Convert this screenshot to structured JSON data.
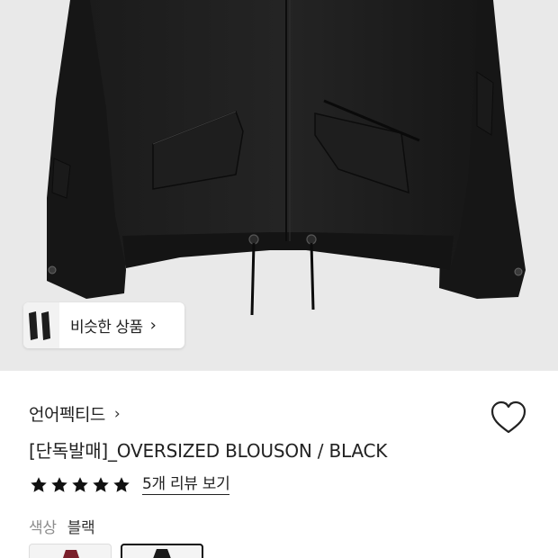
{
  "product_image": {
    "alt": "product-photo"
  },
  "similar": {
    "label": "비슷한 상품",
    "arrow": "›"
  },
  "brand": {
    "name": "언어펙티드",
    "arrow": "›"
  },
  "product": {
    "title": "[단독발매]_OVERSIZED BLOUSON / BLACK"
  },
  "rating": {
    "stars": 5,
    "review_link": "5개 리뷰 보기"
  },
  "color": {
    "label": "색상",
    "value": "블랙"
  },
  "swatches": [
    {
      "name": "burgundy",
      "color": "#7a1f2b",
      "selected": false
    },
    {
      "name": "black",
      "color": "#1a1a1a",
      "selected": true
    }
  ],
  "colors": {
    "star": "#111111",
    "background": "#e9e9e9"
  }
}
